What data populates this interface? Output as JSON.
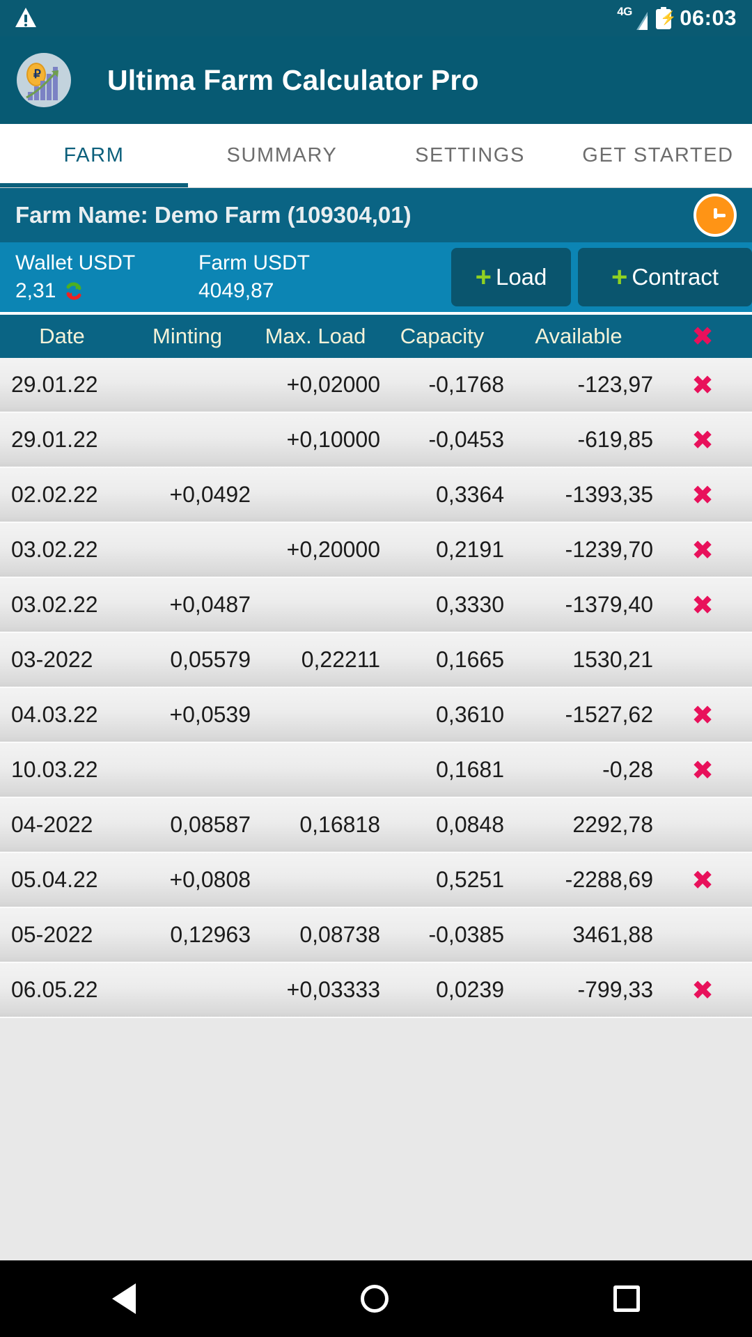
{
  "statusbar": {
    "warning_icon": "warning-triangle-icon",
    "network_label": "4G",
    "signal_icon": "signal-bars-icon",
    "battery_icon": "battery-charging-icon",
    "time": "06:03"
  },
  "appbar": {
    "logo_icon": "app-logo-icon",
    "title": "Ultima Farm Calculator Pro"
  },
  "tabs": [
    {
      "label": "FARM",
      "active": true
    },
    {
      "label": "SUMMARY",
      "active": false
    },
    {
      "label": "SETTINGS",
      "active": false
    },
    {
      "label": "GET STARTED",
      "active": false
    }
  ],
  "farmbar": {
    "text": "Farm Name:  Demo Farm (109304,01)",
    "clock_icon": "clock-icon"
  },
  "wallet": {
    "wallet_label": "Wallet USDT",
    "wallet_value": "2,31",
    "refresh_icon": "refresh-icon",
    "farm_label": "Farm USDT",
    "farm_value": "4049,87",
    "load_button": "Load",
    "contract_button": "Contract",
    "plus_glyph": "+"
  },
  "table": {
    "headers": [
      "Date",
      "Minting",
      "Max. Load",
      "Capacity",
      "Available"
    ],
    "delete_all_icon": "delete-all-icon",
    "delete_glyph": "✖",
    "rows": [
      {
        "date": "29.01.22",
        "minting": "",
        "maxload": "+0,02000",
        "capacity": "-0,1768",
        "available": "-123,97",
        "deletable": true
      },
      {
        "date": "29.01.22",
        "minting": "",
        "maxload": "+0,10000",
        "capacity": "-0,0453",
        "available": "-619,85",
        "deletable": true
      },
      {
        "date": "02.02.22",
        "minting": "+0,0492",
        "maxload": "",
        "capacity": "0,3364",
        "available": "-1393,35",
        "deletable": true
      },
      {
        "date": "03.02.22",
        "minting": "",
        "maxload": "+0,20000",
        "capacity": "0,2191",
        "available": "-1239,70",
        "deletable": true
      },
      {
        "date": "03.02.22",
        "minting": "+0,0487",
        "maxload": "",
        "capacity": "0,3330",
        "available": "-1379,40",
        "deletable": true
      },
      {
        "date": "03-2022",
        "minting": "0,05579",
        "maxload": "0,22211",
        "capacity": "0,1665",
        "available": "1530,21",
        "deletable": false
      },
      {
        "date": "04.03.22",
        "minting": "+0,0539",
        "maxload": "",
        "capacity": "0,3610",
        "available": "-1527,62",
        "deletable": true
      },
      {
        "date": "10.03.22",
        "minting": "",
        "maxload": "",
        "capacity": "0,1681",
        "available": "-0,28",
        "deletable": true
      },
      {
        "date": "04-2022",
        "minting": "0,08587",
        "maxload": "0,16818",
        "capacity": "0,0848",
        "available": "2292,78",
        "deletable": false
      },
      {
        "date": "05.04.22",
        "minting": "+0,0808",
        "maxload": "",
        "capacity": "0,5251",
        "available": "-2288,69",
        "deletable": true
      },
      {
        "date": "05-2022",
        "minting": "0,12963",
        "maxload": "0,08738",
        "capacity": "-0,0385",
        "available": "3461,88",
        "deletable": false
      },
      {
        "date": "06.05.22",
        "minting": "",
        "maxload": "+0,03333",
        "capacity": "0,0239",
        "available": "-799,33",
        "deletable": true
      }
    ]
  },
  "navbar": {
    "back_icon": "nav-back-icon",
    "home_icon": "nav-home-icon",
    "recents_icon": "nav-recents-icon"
  },
  "colors": {
    "status_bar": "#0a5a72",
    "app_bar": "#075a73",
    "farm_bar": "#0a6484",
    "wallet_bar": "#0c85b4",
    "accent": "#0b5f7b",
    "delete_red": "#e8115b",
    "plus_green": "#8fd122",
    "clock_orange": "#ff9415"
  }
}
